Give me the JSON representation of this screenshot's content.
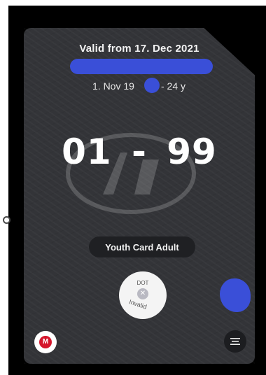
{
  "ticket": {
    "valid_from": "Valid from 17. Dec 2021",
    "dob_left": "1. Nov 19",
    "dob_right": "- 24 y",
    "zones": "01 - 99",
    "type_label": "Youth Card Adult",
    "stamp_top": "DOT",
    "stamp_x": "✕",
    "stamp_bottom": "Invalid",
    "logo_letter": "M"
  },
  "colors": {
    "card": "#333438",
    "redaction": "#3a4fd8",
    "logo": "#d5162c"
  },
  "icons": [
    "operator-logo-icon",
    "menu-icon",
    "invalid-x-icon"
  ]
}
